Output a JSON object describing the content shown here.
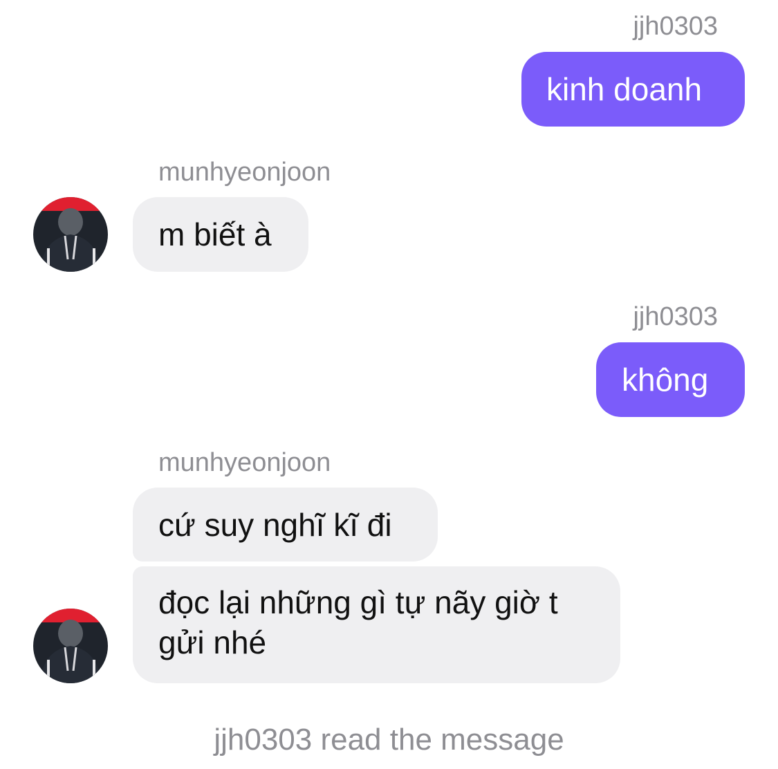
{
  "conversation": {
    "messages": [
      {
        "sender": "jjh0303",
        "text": "kinh doanh",
        "direction": "outgoing"
      },
      {
        "sender": "munhyeonjoon",
        "text": "m biết à",
        "direction": "incoming"
      },
      {
        "sender": "jjh0303",
        "text": "không",
        "direction": "outgoing"
      },
      {
        "sender": "munhyeonjoon",
        "text": "cứ suy nghĩ kĩ đi",
        "direction": "incoming"
      },
      {
        "sender": "munhyeonjoon",
        "text": "đọc lại những gì tự nãy giờ t gửi nhé",
        "direction": "incoming"
      }
    ],
    "read_receipt": "jjh0303 read the message"
  },
  "colors": {
    "outgoing_bubble": "#7b5cfa",
    "incoming_bubble": "#efeff1",
    "meta_text": "#8e8e93"
  },
  "icons": {
    "avatar": "user-avatar-photo"
  }
}
